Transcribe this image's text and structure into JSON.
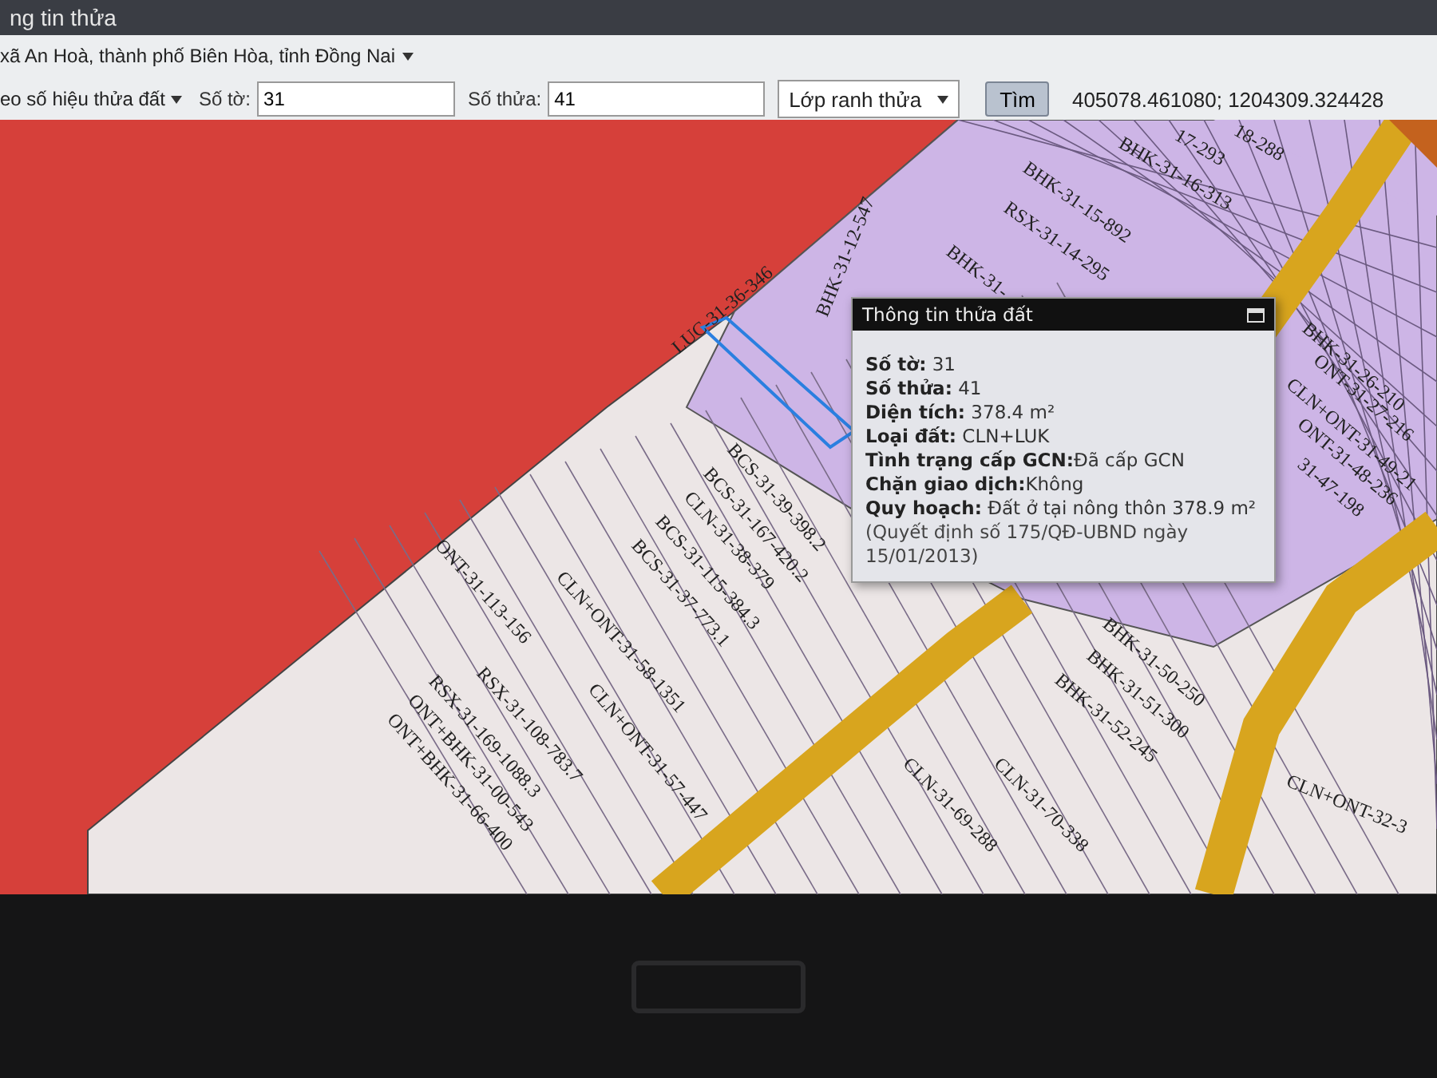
{
  "window": {
    "title": "ng tin thửa"
  },
  "toolbar": {
    "location": "xã An Hoà, thành phố Biên Hòa, tỉnh Đồng Nai",
    "search_mode": "eo số hiệu thửa đất",
    "sheet_label": "Số tờ:",
    "sheet_value": "31",
    "parcel_label": "Số thửa:",
    "parcel_value": "41",
    "layer": "Lớp ranh thửa",
    "search_button": "Tìm",
    "coordinates": "405078.461080; 1204309.324428"
  },
  "map": {
    "labels": [
      "LUC-31-36-346",
      "BHK-31-12-547",
      "BHK-31-15-892",
      "RSX-31-14-295",
      "BHK-31-16-313",
      "BHK-31-",
      "BCS-31-39-398.2",
      "BCS-31-167-420.2",
      "CLN-31-38-379",
      "BCS-31-115-384.3",
      "BCS-31-37-773.1",
      "CLN+ONT-31-58-1351",
      "CLN+ONT-31-57-447",
      "ONT-31-113-156",
      "RSX-31-108-783.7",
      "RSX-31-169-1088.3",
      "ONT+BHK-31-00-543",
      "ONT+BHK-31-66-400",
      "BHK-31-26-210",
      "ONT-31-27-216",
      "CLN+ONT-31-49-21",
      "ONT-31-48-236",
      "31-47-198",
      "BHK-31-50-250",
      "BHK-31-51-300",
      "BHK-31-52-245",
      "CLN-31-69-288",
      "CLN-31-70-338",
      "CLN+ONT-32-3",
      "17-293",
      "18-288"
    ]
  },
  "popup": {
    "title": "Thông tin thửa đất",
    "rows": [
      {
        "label": "Số tờ:",
        "value": " 31"
      },
      {
        "label": "Số thửa:",
        "value": " 41"
      },
      {
        "label": "Diện tích:",
        "value": " 378.4 m²"
      },
      {
        "label": "Loại đất:",
        "value": " CLN+LUK"
      },
      {
        "label": "Tình trạng cấp GCN:",
        "value": "Đã cấp GCN"
      },
      {
        "label": "Chặn giao dịch:",
        "value": "Không"
      },
      {
        "label": "Quy hoạch:",
        "value": " Đất ở tại nông thôn 378.9 m²"
      }
    ],
    "note": "(Quyết định số 175/QĐ-UBND ngày 15/01/2013)"
  }
}
